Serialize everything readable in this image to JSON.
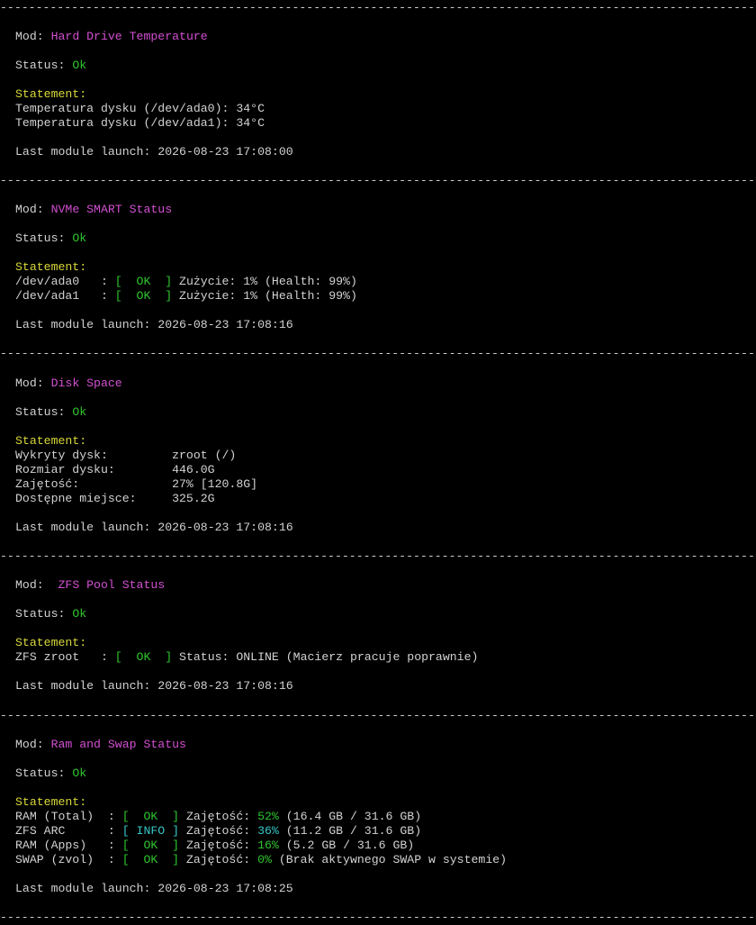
{
  "separator": "--------------------------------------------------------------------------------------------------------------",
  "labels": {
    "mod": "Mod:",
    "status": "Status:",
    "statement": "Statement:",
    "last_launch": "Last module launch:",
    "pad": " "
  },
  "modules": [
    {
      "name": "Hard Drive Temperature",
      "status": "Ok",
      "lines": [
        [
          "Temperatura dysku (/dev/ada0):",
          " 34°C"
        ],
        [
          "Temperatura dysku (/dev/ada1):",
          " 34°C"
        ]
      ],
      "last_launch": "2026-08-23 17:08:00"
    },
    {
      "name": "NVMe SMART Status",
      "status": "Ok",
      "rows": [
        {
          "dev": "/dev/ada0   :",
          "open": " [  ",
          "ok": "OK",
          "close": "  ]",
          "text": " Zużycie: 1% (Health: 99%)"
        },
        {
          "dev": "/dev/ada1   :",
          "open": " [  ",
          "ok": "OK",
          "close": "  ]",
          "text": " Zużycie: 1% (Health: 99%)"
        }
      ],
      "last_launch": "2026-08-23 17:08:16"
    },
    {
      "name": "Disk Space",
      "status": "Ok",
      "kv": [
        {
          "k": "Wykryty dysk:         ",
          "v": "zroot (/)"
        },
        {
          "k": "Rozmiar dysku:        ",
          "v": "446.0G"
        },
        {
          "k": "Zajętość:             ",
          "v": "27% [120.8G]"
        },
        {
          "k": "Dostępne miejsce:     ",
          "v": "325.2G"
        }
      ],
      "last_launch": "2026-08-23 17:08:16"
    },
    {
      "name": " ZFS Pool Status",
      "status": "Ok",
      "rows": [
        {
          "dev": "ZFS zroot   :",
          "open": " [  ",
          "ok": "OK",
          "close": "  ]",
          "text": " Status: ONLINE (Macierz pracuje poprawnie)"
        }
      ],
      "last_launch": "2026-08-23 17:08:16"
    },
    {
      "name": "Ram and Swap Status",
      "status": "Ok",
      "rows": [
        {
          "dev": "RAM (Total)  :",
          "open": " [  ",
          "ok": "OK",
          "close": "  ]",
          "pre": " Zajętość: ",
          "pct": "52%",
          "text": " (16.4 GB / 31.6 GB)"
        },
        {
          "dev": "ZFS ARC      :",
          "open": " [ ",
          "ok": "INFO",
          "close": " ]",
          "pre": " Zajętość: ",
          "pct": "36%",
          "text": " (11.2 GB / 31.6 GB)"
        },
        {
          "dev": "RAM (Apps)   :",
          "open": " [  ",
          "ok": "OK",
          "close": "  ]",
          "pre": " Zajętość: ",
          "pct": "16%",
          "text": " (5.2 GB / 31.6 GB)"
        },
        {
          "dev": "SWAP (zvol)  :",
          "open": " [  ",
          "ok": "OK",
          "close": "  ]",
          "pre": " Zajętość: ",
          "pct": "0%",
          "text": " (Brak aktywnego SWAP w systemie)"
        }
      ],
      "last_launch": "2026-08-23 17:08:25"
    }
  ]
}
